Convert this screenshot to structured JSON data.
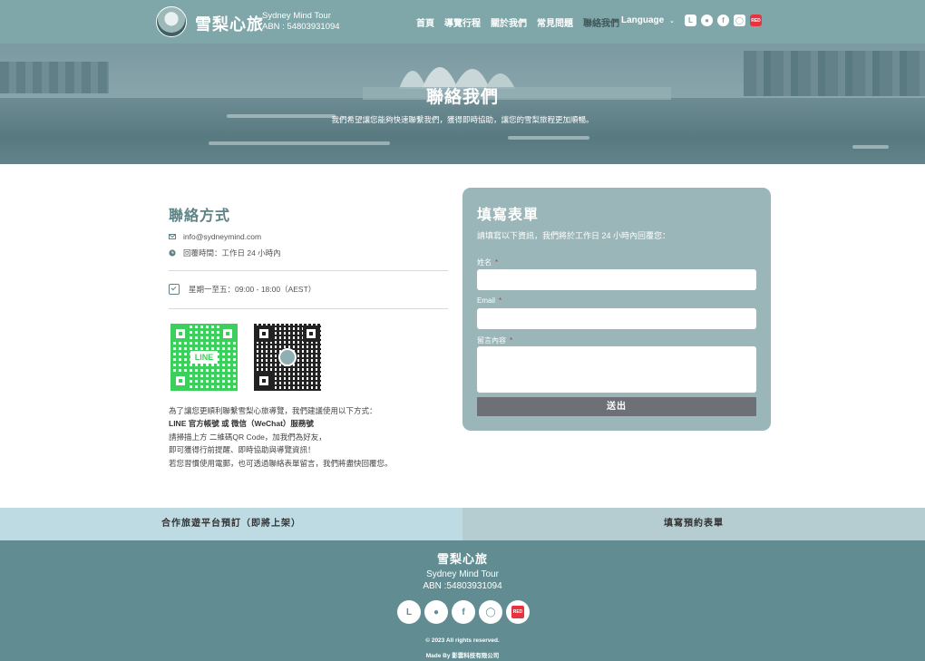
{
  "header": {
    "brand": "雪梨心旅",
    "brand_en": "Sydney Mind Tour",
    "abn": "ABN : 54803931094",
    "nav": [
      "首頁",
      "導覽行程",
      "關於我們",
      "常見問題",
      "聯絡我們"
    ],
    "active_nav": "聯絡我們",
    "language": "Language",
    "social_icons": [
      "line-icon",
      "wechat-icon",
      "facebook-icon",
      "instagram-icon",
      "rednote-icon"
    ]
  },
  "hero": {
    "title": "聯絡我們",
    "subtitle": "我們希望讓您能夠快速聯繫我們，獲得即時協助，讓您的雪梨旅程更加順暢。"
  },
  "contact": {
    "title": "聯絡方式",
    "email": "info@sydneymind.com",
    "reply_time": "回覆時間：工作日 24 小時內",
    "hours": "星期一至五：09:00 - 18:00（AEST）",
    "qr_line_label": "LINE",
    "desc_line1": "為了讓您更順利聯繫雪梨心旅導覽，我們建議使用以下方式：",
    "desc_line2": "LINE 官方帳號 或 微信（WeChat）服務號",
    "desc_line3": "請掃描上方 二維碼QR Code，加我們為好友，",
    "desc_line4": "即可獲得行前提醒、即時協助與導覽資訊！",
    "desc_line5": "若您習慣使用電郵，也可透過聯絡表單留言，我們將盡快回覆您。"
  },
  "form": {
    "title": "填寫表單",
    "subtitle": "請填寫以下資訊，我們將於工作日 24 小時內回覆您：",
    "name_label": "姓名",
    "email_label": "Email",
    "message_label": "留言內容",
    "required_mark": "*",
    "submit": "送出"
  },
  "booking": {
    "left": "合作旅遊平台預訂（即將上架）",
    "right": "填寫預約表單"
  },
  "footer": {
    "brand": "雪梨心旅",
    "brand_en": "Sydney Mind Tour",
    "abn": "ABN :54803931094",
    "copyright": "© 2023 All rights reserved.",
    "made_by": "Made By 影雲科技有限公司"
  },
  "colors": {
    "header_bg": "#7fa6a8",
    "form_bg": "#9ab6b9",
    "footer_bg": "#618d92",
    "title_accent": "#5e8386",
    "button_bg": "#6e7078"
  }
}
